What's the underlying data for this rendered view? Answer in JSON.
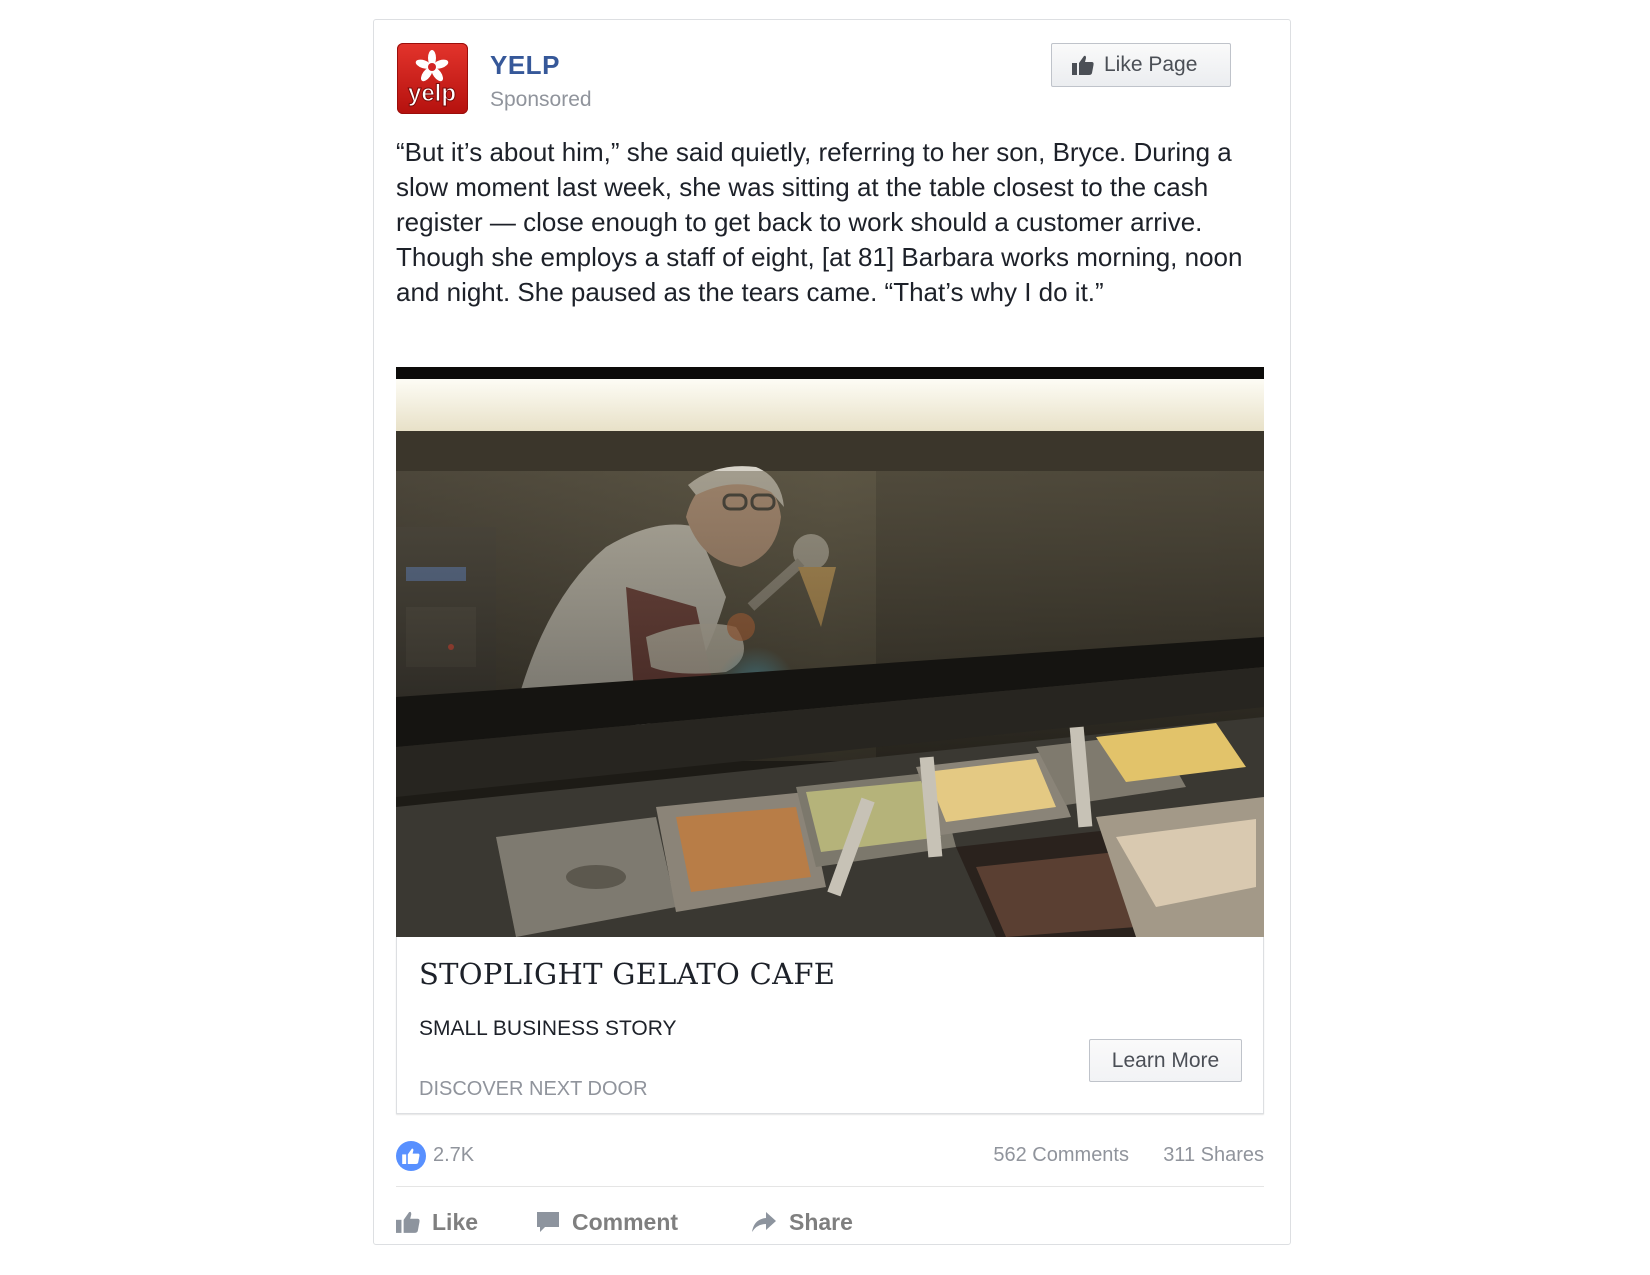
{
  "post": {
    "page_name": "YELP",
    "sponsored_label": "Sponsored",
    "like_page_label": "Like Page",
    "body": "“But it’s about him,” she said quietly, referring to her son, Bryce. During a slow moment last week, she was sitting at the table closest to the cash register — close enough to get back to work should a customer arrive. Though she employs a staff of eight, [at 81] Barbara works morning, noon and night. She paused as the tears came. “That’s why I do it.”"
  },
  "logo": {
    "text": "yelp",
    "icon": "yelp-burst-icon",
    "color": "#d32323"
  },
  "link": {
    "title": "STOPLIGHT GELATO CAFE",
    "subtitle": "SMALL BUSINESS STORY",
    "domain": "DISCOVER NEXT DOOR",
    "cta_label": "Learn More",
    "image_icon": "gelato-counter-photo"
  },
  "stats": {
    "likes": "2.7K",
    "comments": "562 Comments",
    "shares": "311 Shares"
  },
  "actions": {
    "like": "Like",
    "comment": "Comment",
    "share": "Share"
  },
  "colors": {
    "link_blue": "#365899",
    "like_blue": "#5890ff",
    "meta_gray": "#90949c"
  }
}
